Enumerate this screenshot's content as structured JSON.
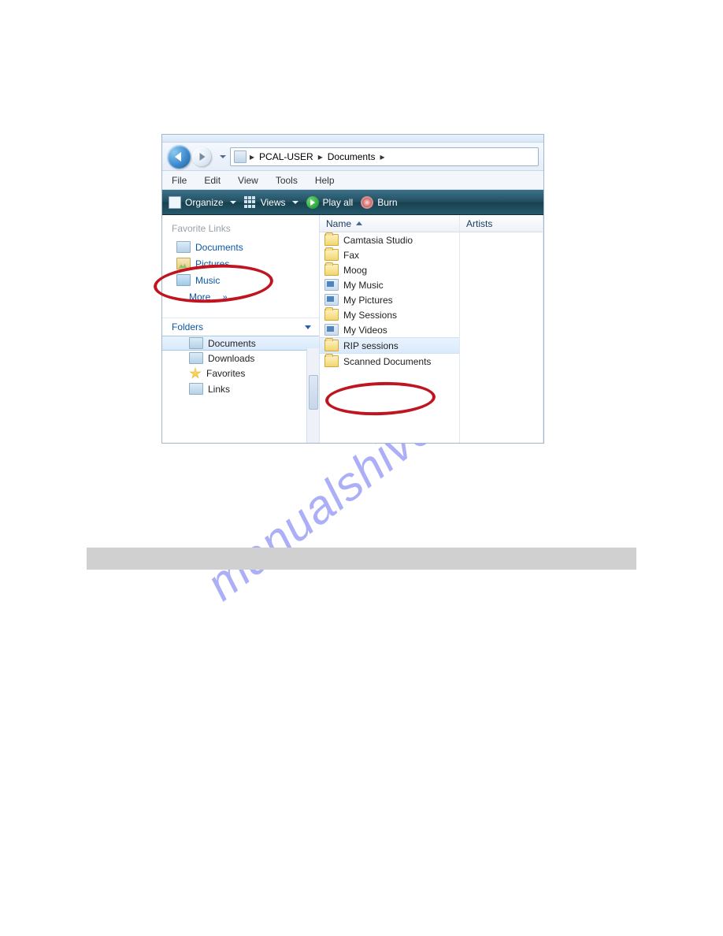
{
  "watermark": "manualshive.com",
  "breadcrumb": {
    "level1": "PCAL-USER",
    "level2": "Documents"
  },
  "menu": {
    "file": "File",
    "edit": "Edit",
    "view": "View",
    "tools": "Tools",
    "help": "Help"
  },
  "toolbar": {
    "organize": "Organize",
    "views": "Views",
    "playall": "Play all",
    "burn": "Burn"
  },
  "favorites": {
    "header": "Favorite Links",
    "documents": "Documents",
    "pictures": "Pictures",
    "music": "Music",
    "more": "More",
    "more_glyph": "»"
  },
  "folders": {
    "header": "Folders",
    "documents": "Documents",
    "downloads": "Downloads",
    "favorites": "Favorites",
    "links": "Links"
  },
  "columns": {
    "name": "Name",
    "artists": "Artists"
  },
  "files": {
    "camtasia": "Camtasia Studio",
    "fax": "Fax",
    "moog": "Moog",
    "mymusic": "My Music",
    "mypictures": "My Pictures",
    "mysessions": "My Sessions",
    "myvideos": "My Videos",
    "rip": "RIP sessions",
    "scanned": "Scanned Documents"
  }
}
